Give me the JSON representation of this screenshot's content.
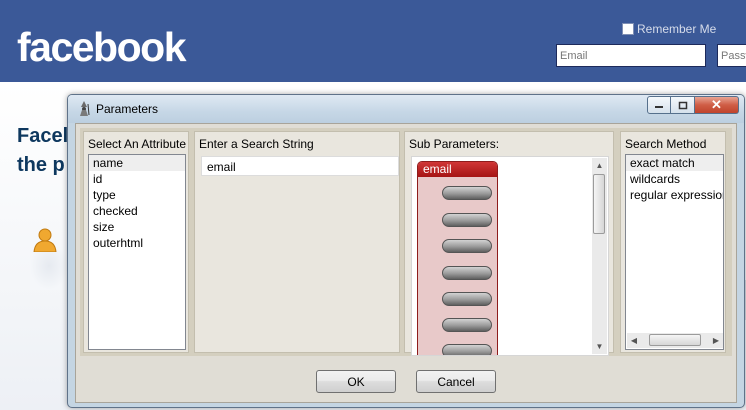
{
  "background": {
    "logo": "facebook",
    "remember_me_label": "Remember Me",
    "email_placeholder": "Email",
    "password_placeholder": "Passw",
    "tagline_line1": "Facel",
    "tagline_line2": "the p",
    "brand_color": "#3b5998"
  },
  "dialog": {
    "title": "Parameters",
    "title_icon": "wizard-icon",
    "window_buttons": {
      "minimize": "minimize-icon",
      "maximize": "maximize-icon",
      "close_glyph": "✕"
    },
    "attribute_panel": {
      "label": "Select An Attribute",
      "items": [
        "name",
        "id",
        "type",
        "checked",
        "size",
        "outerhtml"
      ],
      "selected": "name"
    },
    "search_panel": {
      "label": "Enter a Search String",
      "value": "email"
    },
    "sub_params_panel": {
      "label": "Sub Parameters:",
      "group_title": "email",
      "pill_count": 8
    },
    "method_panel": {
      "label": "Search Method",
      "items": [
        "exact match",
        "wildcards",
        "regular expression"
      ],
      "selected": "exact match"
    },
    "ok_label": "OK",
    "cancel_label": "Cancel"
  }
}
